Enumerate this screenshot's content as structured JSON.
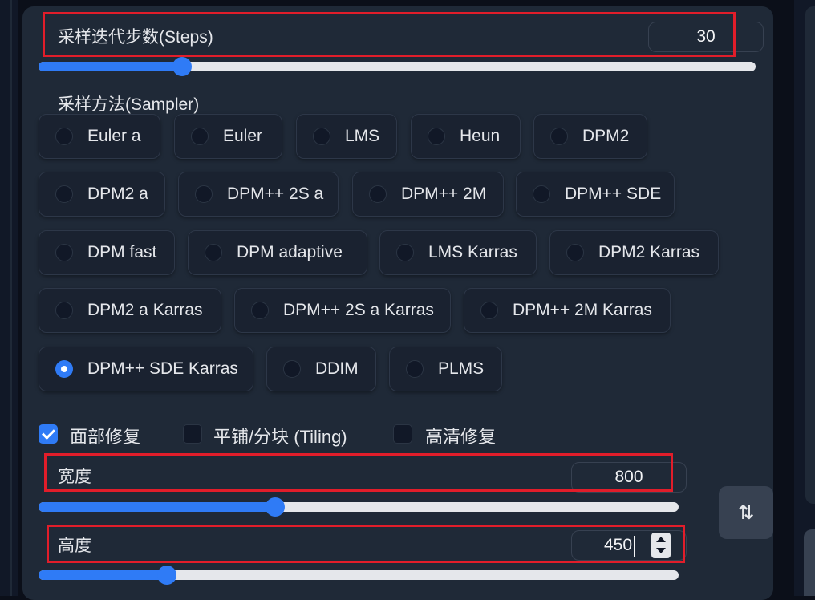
{
  "steps": {
    "label": "采样迭代步数(Steps)",
    "value": "30",
    "fraction": 0.2
  },
  "sampler": {
    "label": "采样方法(Sampler)",
    "options": [
      "Euler a",
      "Euler",
      "LMS",
      "Heun",
      "DPM2",
      "DPM2 a",
      "DPM++ 2S a",
      "DPM++ 2M",
      "DPM++ SDE",
      "DPM fast",
      "DPM adaptive",
      "LMS Karras",
      "DPM2 Karras",
      "DPM2 a Karras",
      "DPM++ 2S a Karras",
      "DPM++ 2M Karras",
      "DPM++ SDE Karras",
      "DDIM",
      "PLMS"
    ],
    "selected": "DPM++ SDE Karras"
  },
  "options": [
    {
      "label": "面部修复",
      "checked": true
    },
    {
      "label": "平铺/分块 (Tiling)",
      "checked": false
    },
    {
      "label": "高清修复",
      "checked": false
    }
  ],
  "width": {
    "label": "宽度",
    "value": "800",
    "fraction": 0.37
  },
  "height": {
    "label": "高度",
    "value": "450",
    "fraction": 0.2
  },
  "swap_icon": "swap-vertical-icon",
  "colors": {
    "accent": "#2f7bf6",
    "highlight": "#e11d2a",
    "panel": "#1f2937"
  }
}
